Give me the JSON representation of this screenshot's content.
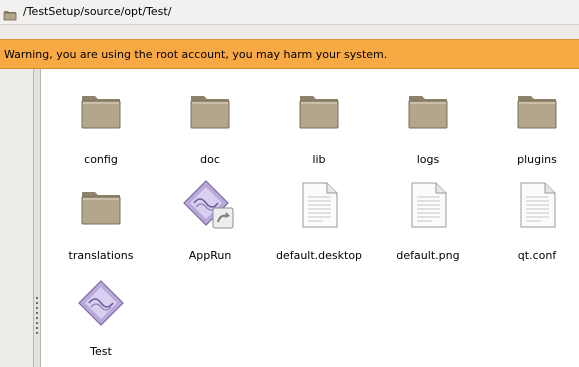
{
  "location": {
    "path": "/TestSetup/source/opt/Test/",
    "icon": "folder-icon"
  },
  "warning": {
    "text": "Warning, you are using the root account, you may harm your system."
  },
  "files": [
    {
      "name": "config",
      "icon": "folder-icon"
    },
    {
      "name": "doc",
      "icon": "folder-icon"
    },
    {
      "name": "lib",
      "icon": "folder-icon"
    },
    {
      "name": "logs",
      "icon": "folder-icon"
    },
    {
      "name": "plugins",
      "icon": "folder-icon"
    },
    {
      "name": "translations",
      "icon": "folder-icon"
    },
    {
      "name": "AppRun",
      "icon": "app-link-icon"
    },
    {
      "name": "default.desktop",
      "icon": "text-file-icon"
    },
    {
      "name": "default.png",
      "icon": "text-file-icon"
    },
    {
      "name": "qt.conf",
      "icon": "text-file-icon"
    },
    {
      "name": "Test",
      "icon": "app-icon"
    }
  ],
  "colors": {
    "warning": "#f8a944",
    "folder": "#b4a68d"
  }
}
